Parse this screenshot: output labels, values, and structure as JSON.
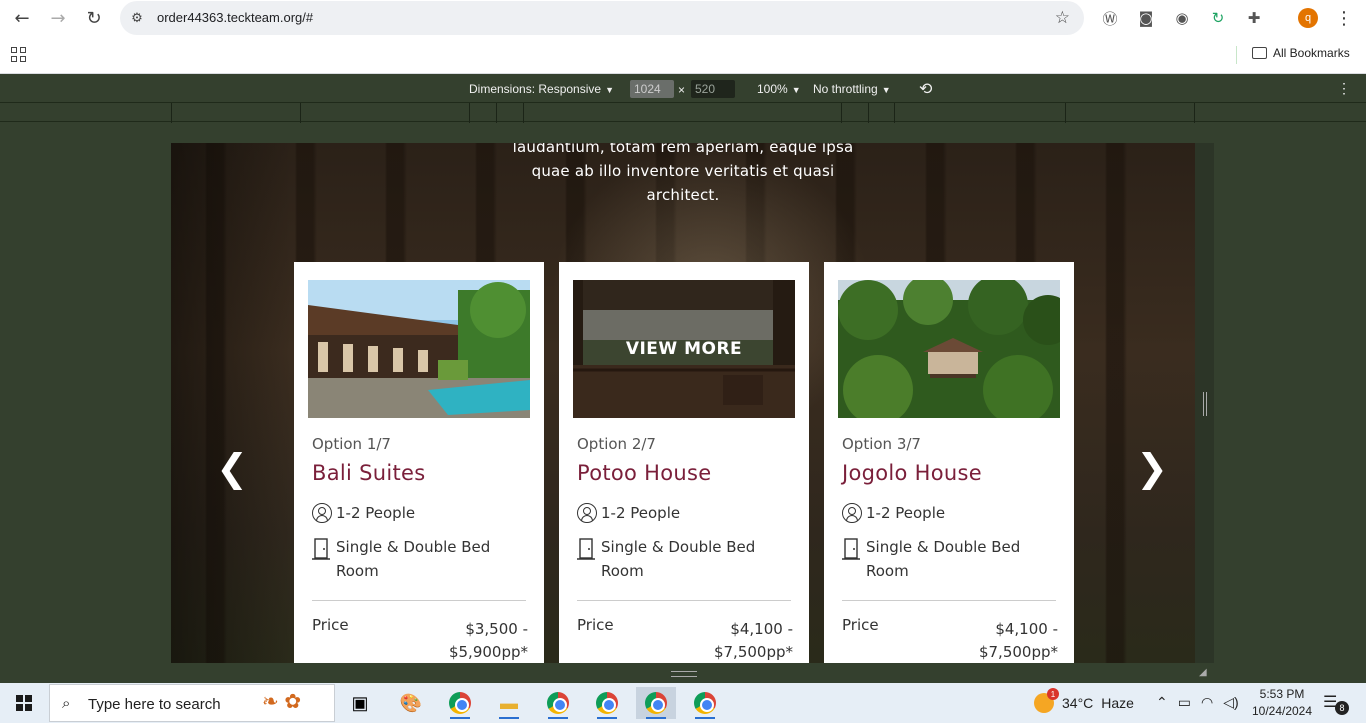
{
  "browser": {
    "url": "order44363.teckteam.org/#",
    "all_bookmarks": "All Bookmarks",
    "profile_letter": "q"
  },
  "device_toolbar": {
    "dimensions_label": "Dimensions: Responsive",
    "width_value": "1024",
    "height_value": "520",
    "times": "×",
    "zoom": "100%",
    "throttling": "No throttling"
  },
  "page": {
    "intro_lines": [
      "laudantium, totam rem aperiam, eaque ipsa",
      "quae ab illo inventore veritatis et quasi",
      "architect."
    ],
    "prev_arrow": "❮",
    "next_arrow": "❯",
    "cards": [
      {
        "option": "Option 1/7",
        "name": "Bali Suites",
        "people": "1-2 People",
        "bed": "Single & Double Bed Room",
        "price_label": "Price",
        "price_line1": "$3,500 -",
        "price_line2": "$5,900pp*",
        "overlay": ""
      },
      {
        "option": "Option 2/7",
        "name": "Potoo House",
        "people": "1-2 People",
        "bed": "Single & Double Bed Room",
        "price_label": "Price",
        "price_line1": "$4,100 -",
        "price_line2": "$7,500pp*",
        "overlay": "VIEW MORE"
      },
      {
        "option": "Option 3/7",
        "name": "Jogolo House",
        "people": "1-2 People",
        "bed": "Single & Double Bed Room",
        "price_label": "Price",
        "price_line1": "$4,100 -",
        "price_line2": "$7,500pp*",
        "overlay": ""
      }
    ]
  },
  "taskbar": {
    "search_placeholder": "Type here to search",
    "temperature": "34°C",
    "weather": "Haze",
    "weather_badge": "1",
    "time": "5:53 PM",
    "date": "10/24/2024",
    "notification_count": "8"
  },
  "colors": {
    "accent_name": "#7a1f3a",
    "devtools_bg": "#34402e"
  }
}
